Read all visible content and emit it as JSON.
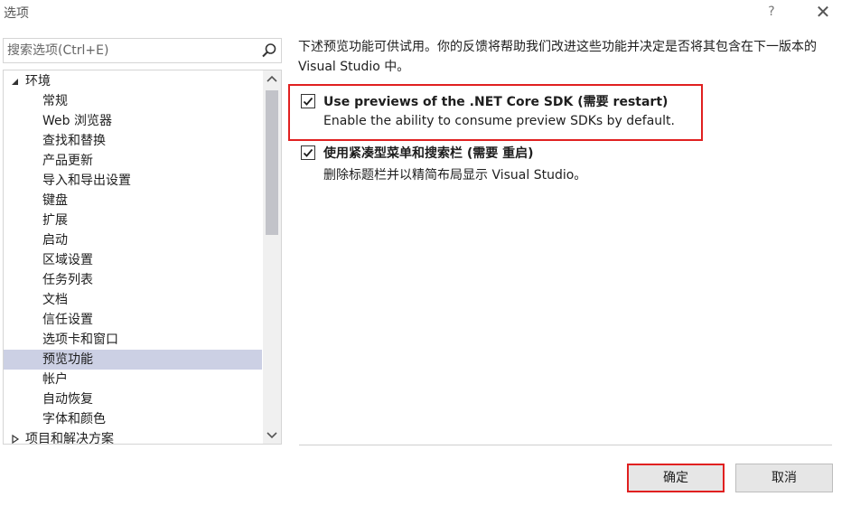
{
  "window": {
    "title": "选项",
    "help_label": "?",
    "close_label": "✕"
  },
  "search": {
    "placeholder": "搜索选项(Ctrl+E)",
    "value": ""
  },
  "tree": {
    "root_label": "环境",
    "items": [
      {
        "label": "常规"
      },
      {
        "label": "Web 浏览器"
      },
      {
        "label": "查找和替换"
      },
      {
        "label": "产品更新"
      },
      {
        "label": "导入和导出设置"
      },
      {
        "label": "键盘"
      },
      {
        "label": "扩展"
      },
      {
        "label": "启动"
      },
      {
        "label": "区域设置"
      },
      {
        "label": "任务列表"
      },
      {
        "label": "文档"
      },
      {
        "label": "信任设置"
      },
      {
        "label": "选项卡和窗口"
      },
      {
        "label": "预览功能",
        "selected": true
      },
      {
        "label": "帐户"
      },
      {
        "label": "自动恢复"
      },
      {
        "label": "字体和颜色"
      }
    ],
    "next_root_label": "项目和解决方案"
  },
  "panel": {
    "description": "下述预览功能可供试用。你的反馈将帮助我们改进这些功能并决定是否将其包含在下一版本的 Visual Studio 中。",
    "options": [
      {
        "title": "Use previews of the .NET Core SDK (需要 restart)",
        "subtitle": "Enable the ability to consume preview SDKs by default.",
        "checked": true
      },
      {
        "title": "使用紧凑型菜单和搜索栏 (需要 重启)",
        "subtitle": "删除标题栏并以精简布局显示 Visual Studio。",
        "checked": true
      }
    ]
  },
  "buttons": {
    "ok_label": "确定",
    "cancel_label": "取消"
  },
  "colors": {
    "selection": "#ccd0e4",
    "highlight_border": "#e02020",
    "button_bg": "#e6e6e6"
  }
}
